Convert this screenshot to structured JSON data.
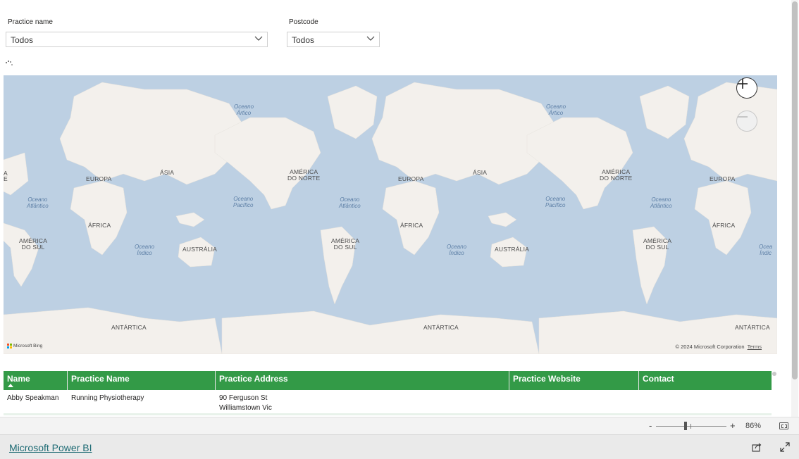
{
  "slicers": [
    {
      "label": "Practice name",
      "value": "Todos"
    },
    {
      "label": "Postcode",
      "value": "Todos"
    }
  ],
  "map": {
    "labels": {
      "europa1": "EUROPA",
      "asia1": "ÁSIA",
      "africa1": "ÁFRICA",
      "america_sul1": "AMÉRICA\nDO SUL",
      "australia1": "AUSTRÁLIA",
      "antartica1": "ANTÁRTICA",
      "america_norte1": "AMÉRICA\nDO NORTE",
      "europa2": "EUROPA",
      "asia2": "ÁSIA",
      "africa2": "ÁFRICA",
      "america_sul2": "AMÉRICA\nDO SUL",
      "australia2": "AUSTRÁLIA",
      "antartica2": "ANTÁRTICA",
      "america_norte2": "AMÉRICA\nDO NORTE",
      "europa3": "EUROPA",
      "africa3": "ÁFRICA",
      "antartica3": "ANTÁRTICA",
      "america_sul0": "AMÉRICA\nDO SUL",
      "edge_a": "A",
      "edge_e": "E"
    },
    "oceans": {
      "artico1": "Oceano\nÁrtico",
      "artico2": "Oceano\nÁrtico",
      "atlantico1": "Oceano\nAtlântico",
      "atlantico2": "Oceano\nAtlântico",
      "atlantico3": "Oceano\nAtlântico",
      "pacifico1": "Oceano\nPacífico",
      "pacifico2": "Oceano\nPacífico",
      "indico1": "Oceano\nÍndico",
      "indico2": "Oceano\nÍndico",
      "indico3": "Ocea\nÍndic"
    },
    "bing": "Microsoft Bing",
    "copyright": "© 2024 Microsoft Corporation",
    "terms": "Terms",
    "zoom_in_icon": "plus-icon",
    "zoom_out_icon": "minus-icon",
    "colors": {
      "ocean": "#bdd0e3",
      "land": "#f3f0ec"
    }
  },
  "table": {
    "headers": [
      "Name",
      "Practice Name",
      "Practice Address",
      "Practice Website",
      "Contact"
    ],
    "rows": [
      {
        "name": "Abby Speakman",
        "practice_name": "Running Physiotherapy",
        "address_line1": "90 Ferguson St",
        "address_line2": "Williamstown Vic",
        "website": "",
        "contact": ""
      }
    ],
    "header_color": "#339a47"
  },
  "zoom": {
    "minus": "-",
    "plus": "+",
    "percent": "86%",
    "level": 0.43
  },
  "footer": {
    "link": "Microsoft Power BI",
    "share_icon": "share-icon",
    "fullscreen_icon": "expand-icon"
  }
}
